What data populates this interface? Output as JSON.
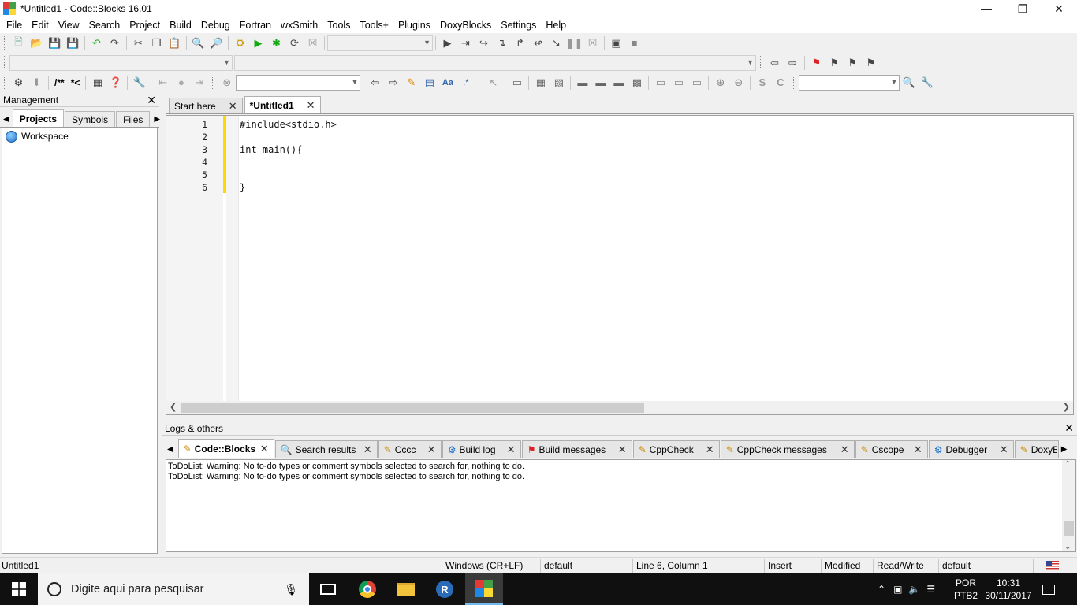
{
  "window": {
    "title": "*Untitled1 - Code::Blocks 16.01"
  },
  "menubar": [
    "File",
    "Edit",
    "View",
    "Search",
    "Project",
    "Build",
    "Debug",
    "Fortran",
    "wxSmith",
    "Tools",
    "Tools+",
    "Plugins",
    "DoxyBlocks",
    "Settings",
    "Help"
  ],
  "toolbar3": {
    "doc_comment": "/**",
    "line_comment": "*<"
  },
  "management": {
    "title": "Management",
    "tabs": [
      "Projects",
      "Symbols",
      "Files"
    ],
    "tree_root": "Workspace"
  },
  "editor": {
    "tabs": [
      {
        "label": "Start here",
        "active": false
      },
      {
        "label": "*Untitled1",
        "active": true
      }
    ],
    "lines": [
      {
        "num": "1",
        "code": "#include<stdio.h>"
      },
      {
        "num": "2",
        "code": ""
      },
      {
        "num": "3",
        "code": "int main(){"
      },
      {
        "num": "4",
        "code": ""
      },
      {
        "num": "5",
        "code": ""
      },
      {
        "num": "6",
        "code": "}"
      }
    ]
  },
  "logs": {
    "title": "Logs & others",
    "tabs": [
      {
        "label": "Code::Blocks",
        "icon": "pencil-icon",
        "active": true
      },
      {
        "label": "Search results",
        "icon": "magnifier-icon",
        "active": false
      },
      {
        "label": "Cccc",
        "icon": "pencil-icon",
        "active": false
      },
      {
        "label": "Build log",
        "icon": "gear-icon",
        "active": false
      },
      {
        "label": "Build messages",
        "icon": "flag-icon",
        "active": false
      },
      {
        "label": "CppCheck",
        "icon": "pencil-icon",
        "active": false
      },
      {
        "label": "CppCheck messages",
        "icon": "pencil-icon",
        "active": false
      },
      {
        "label": "Cscope",
        "icon": "pencil-icon",
        "active": false
      },
      {
        "label": "Debugger",
        "icon": "gear-icon",
        "active": false
      },
      {
        "label": "DoxyB",
        "icon": "pencil-icon",
        "active": false
      }
    ],
    "lines": [
      "ToDoList: Warning: No to-do types or comment symbols selected to search for, nothing to do.",
      "ToDoList: Warning: No to-do types or comment symbols selected to search for, nothing to do."
    ]
  },
  "status": {
    "file": "Untitled1",
    "eol": "Windows (CR+LF)",
    "encoding": "default",
    "position": "Line 6, Column 1",
    "mode": "Insert",
    "modified": "Modified",
    "access": "Read/Write",
    "lang": "default"
  },
  "taskbar": {
    "search_placeholder": "Digite aqui para pesquisar",
    "lang_top": "POR",
    "lang_bottom": "PTB2",
    "time": "10:31",
    "date": "30/11/2017"
  },
  "colors": {
    "changebar": "#ffd800",
    "taskbar": "#101010",
    "accent": "#0078d7"
  }
}
